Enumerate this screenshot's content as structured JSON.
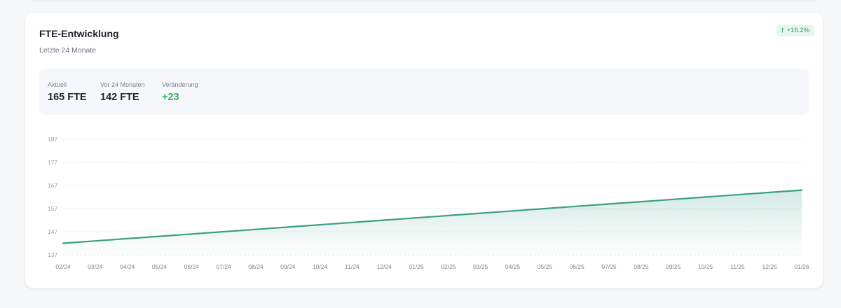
{
  "card": {
    "title": "FTE-Entwicklung",
    "subtitle": "Letzte 24 Monate",
    "badge": "+16.2%",
    "badge_icon": "arrow-up-icon"
  },
  "stats": [
    {
      "label": "Aktuell",
      "value": "165 FTE"
    },
    {
      "label": "Vor 24 Monaten",
      "value": "142 FTE"
    },
    {
      "label": "Veränderung",
      "value": "+23"
    }
  ],
  "colors": {
    "line": "#3d9e86",
    "positive": "#2fb35f",
    "badge_bg": "#e7f6ec"
  },
  "chart_data": {
    "type": "area",
    "x": [
      "02/24",
      "03/24",
      "04/24",
      "05/24",
      "06/24",
      "07/24",
      "08/24",
      "09/24",
      "10/24",
      "11/24",
      "12/24",
      "01/25",
      "02/25",
      "03/25",
      "04/25",
      "05/25",
      "06/25",
      "07/25",
      "08/25",
      "09/25",
      "10/25",
      "11/25",
      "12/25",
      "01/26"
    ],
    "series": [
      {
        "values": [
          142,
          143,
          144,
          145,
          146,
          147,
          148,
          149,
          150,
          151,
          152,
          153,
          154,
          155,
          156,
          157,
          158,
          159,
          160,
          161,
          162,
          163,
          164,
          165
        ]
      }
    ],
    "yticks": [
      137,
      147,
      157,
      167,
      177,
      187
    ],
    "ylim": [
      137,
      187
    ],
    "grid": true
  }
}
